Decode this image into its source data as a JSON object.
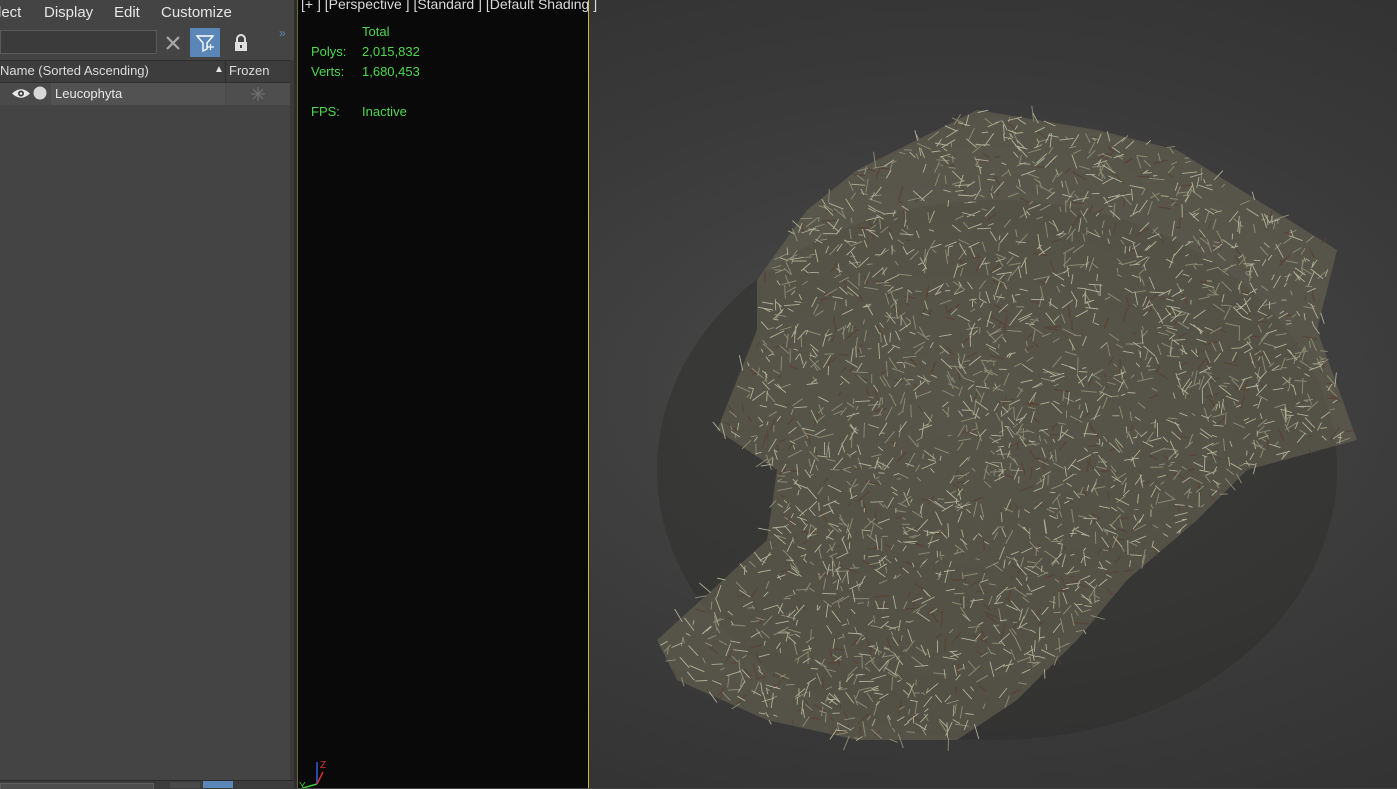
{
  "menu": {
    "items": [
      "lect",
      "Display",
      "Edit",
      "Customize"
    ]
  },
  "toolbar": {
    "search_placeholder": "",
    "clear_icon": "close-icon",
    "filter_icon": "filter-icon",
    "lock_icon": "lock-icon",
    "expand_icon": "double-chevron-icon",
    "accent_color": "#5b87b8"
  },
  "explorer": {
    "columns": {
      "name": "Name (Sorted Ascending)",
      "frozen": "Frozen"
    },
    "rows": [
      {
        "label": "Leucophyta",
        "visible_icon": "eye-icon",
        "render_icon": "circle-icon",
        "frozen_icon": "snowflake-icon"
      }
    ]
  },
  "viewport": {
    "label": "[+ ] [Perspective ] [Standard ] [Default Shading ]",
    "stats": {
      "total_label": "Total",
      "polys_label": "Polys:",
      "polys_value": "2,015,832",
      "verts_label": "Verts:",
      "verts_value": "1,680,453",
      "fps_label": "FPS:",
      "fps_value": "Inactive"
    },
    "stats_color": "#4ed84e",
    "frame_color": "#c8b84a",
    "gizmo": {
      "z": "Z",
      "y": "Y"
    }
  }
}
